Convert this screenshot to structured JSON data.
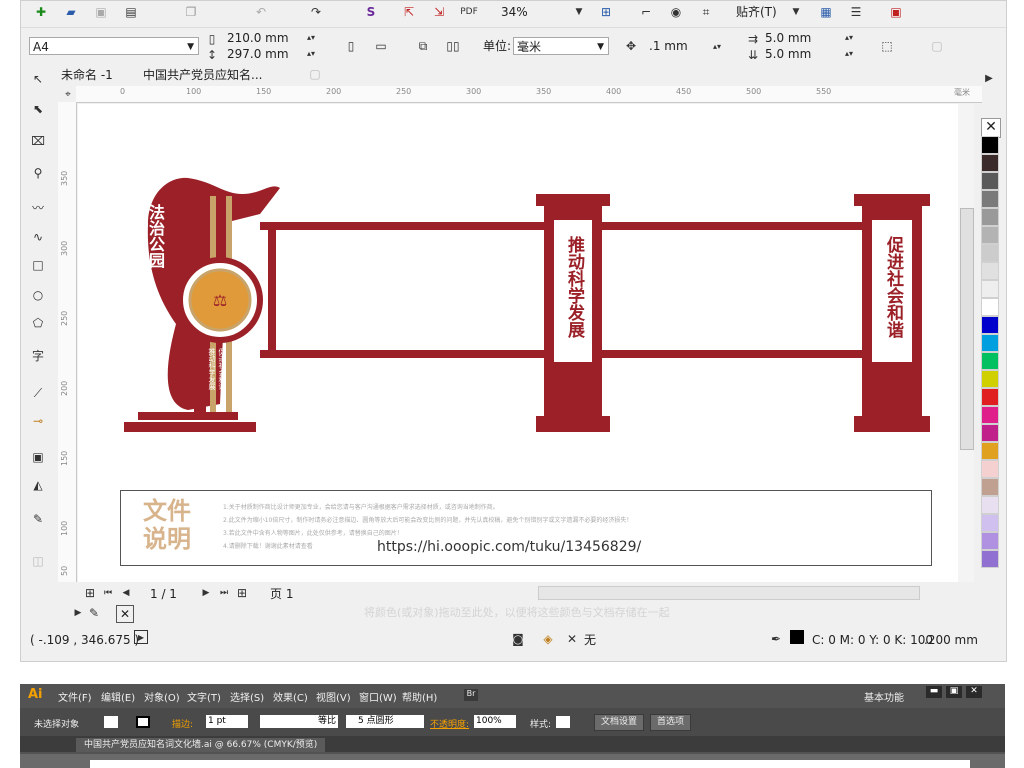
{
  "toolbar1": {
    "zoom": "34%",
    "snap_label": "贴齐(T)"
  },
  "toolbar2": {
    "page_size": "A4",
    "width": "210.0 mm",
    "height": "297.0 mm",
    "units_label": "单位:",
    "units_value": "毫米",
    "nudge": ".1 mm",
    "dup_x": "5.0 mm",
    "dup_y": "5.0 mm"
  },
  "tabs": [
    "未命名 -1",
    "中国共产党员应知名..."
  ],
  "ruler_h_ticks": [
    "0",
    "100",
    "150",
    "200",
    "250",
    "300",
    "350",
    "400",
    "450",
    "500",
    "550"
  ],
  "ruler_h_unit": "毫米",
  "ruler_v_ticks": [
    "350",
    "300",
    "250",
    "200",
    "150",
    "100",
    "50"
  ],
  "artwork": {
    "left_title": "法治公园",
    "left_small": "推动科学发展",
    "left_small2": "促进社会和谐",
    "mid_panel": "推动科学发展",
    "right_panel": "促进社会和谐"
  },
  "notes": {
    "title_line1": "文件",
    "title_line2": "说明",
    "lines": [
      "1.关于材质制作商比设计师更加专业，会给您请与客户沟通根据客户需求选择材质，或咨询当地制作商。",
      "2.此文件为缩小10倍尺寸，制作时请务必注意描边、圆角等放大后可能会改变比例的问题，并先认真校稿，避免个别错别字或文字遗漏不必要的经济损失！",
      "3.若此文件中含有人物等图片，此处仅供参考，请替换自己的图片！",
      "4.请删除下载！谢谢此素材请查看"
    ],
    "url": "https://hi.ooopic.com/tuku/13456829/"
  },
  "page_nav": {
    "counter": "1 / 1",
    "page_tab": "页 1"
  },
  "palette_hint": "将颜色(或对象)拖动至此处，以便将这些颜色与文档存储在一起",
  "status": {
    "coords": "( -.109 , 346.675 )",
    "fill_none": "无",
    "color_info": "C: 0 M: 0 Y: 0 K: 100",
    "stroke": ".200 mm"
  },
  "swatches": [
    "#000000",
    "#3a2a2a",
    "#5a5a5a",
    "#7a7a7a",
    "#999999",
    "#b3b3b3",
    "#cccccc",
    "#e0e0e0",
    "#eeeeee",
    "#ffffff",
    "#0000cc",
    "#00a0e0",
    "#00c060",
    "#d0d000",
    "#e02020",
    "#e0208a",
    "#c0208a",
    "#e0a020",
    "#f5d0d0",
    "#c0a090",
    "#e8e0f0",
    "#d0c0f0",
    "#b090e0",
    "#9070d0"
  ],
  "colors": {
    "brand_red": "#9b2028",
    "gold": "#c9a46a",
    "note_title": "#d8b48c"
  },
  "illustrator": {
    "logo": "Ai",
    "menus": [
      "文件(F)",
      "编辑(E)",
      "对象(O)",
      "文字(T)",
      "选择(S)",
      "效果(C)",
      "视图(V)",
      "窗口(W)",
      "帮助(H)"
    ],
    "bridge": "Br",
    "workspace": "基本功能",
    "no_selection": "未选择对象",
    "stroke_label": "描边:",
    "stroke_value": "1 pt",
    "uniform": "等比",
    "brush": "5 点圆形",
    "opacity_label": "不透明度:",
    "opacity_value": "100%",
    "style_label": "样式:",
    "doc_setup": "文档设置",
    "prefs": "首选项",
    "doc_tab": "中国共产党员应知名词文化墙.ai @ 66.67% (CMYK/预览)"
  }
}
